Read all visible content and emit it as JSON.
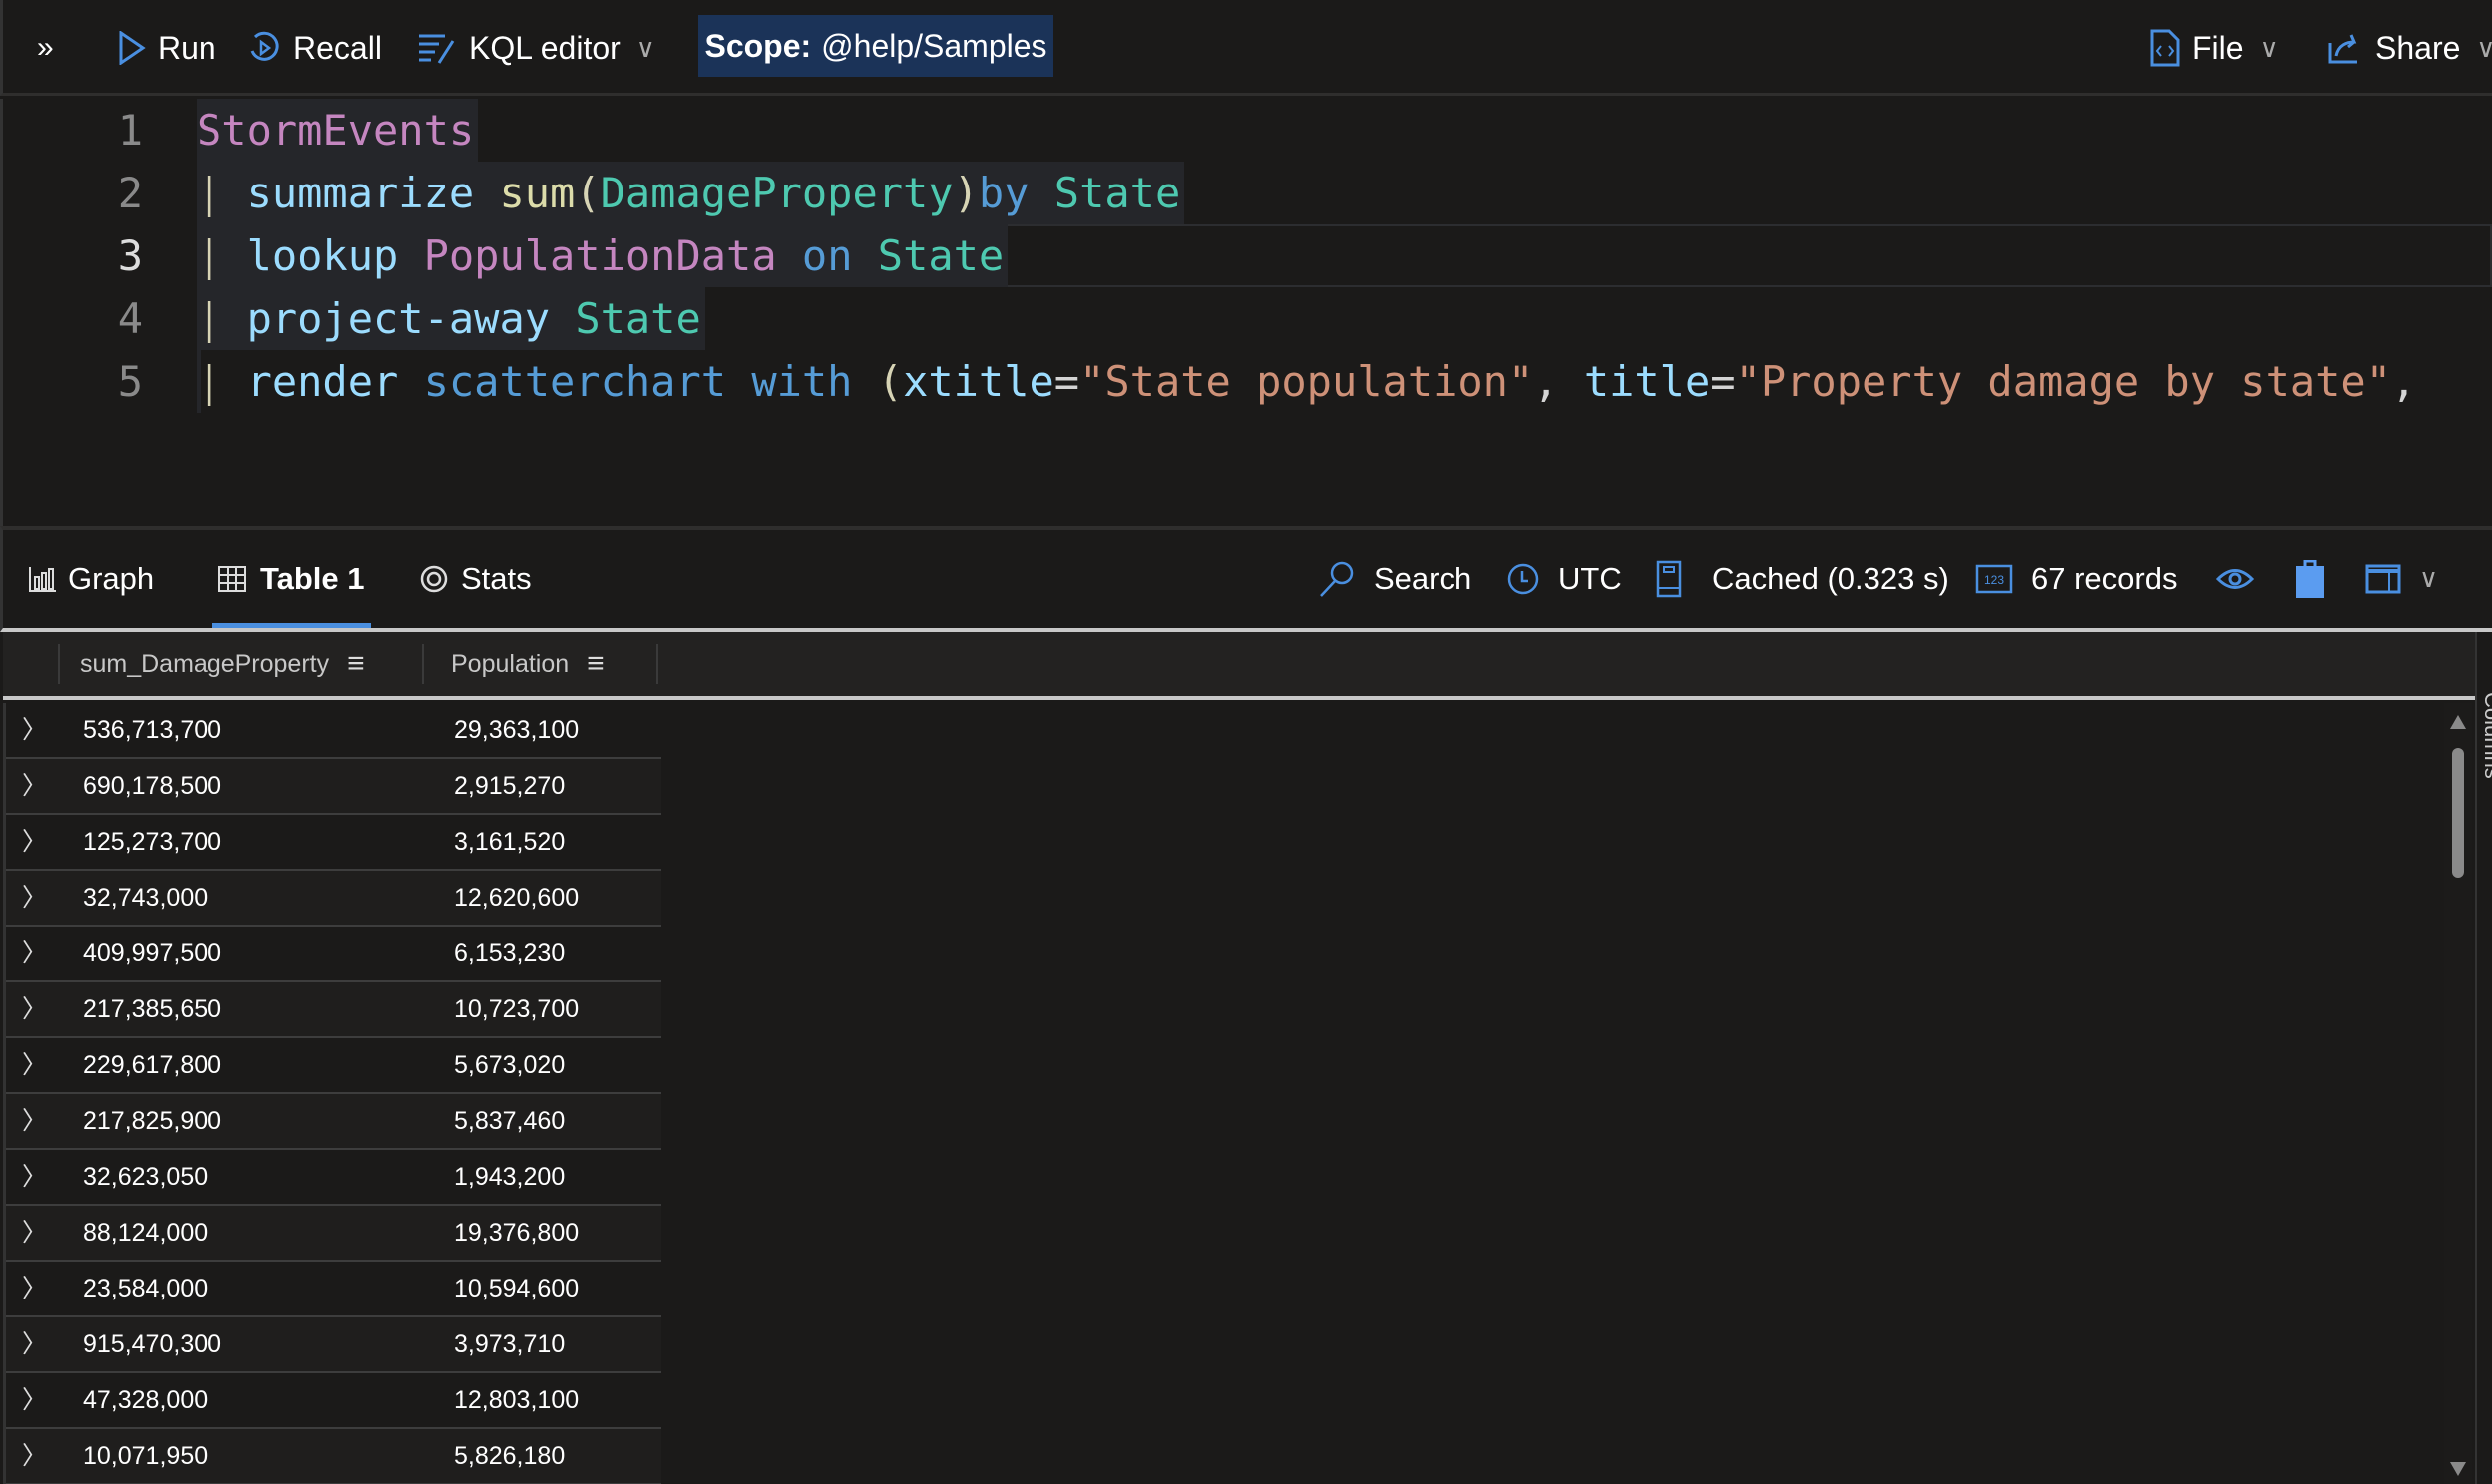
{
  "toolbar": {
    "run": "Run",
    "recall": "Recall",
    "kql_editor": "KQL editor",
    "scope_label": "Scope:",
    "scope_value": "@help/Samples",
    "file": "File",
    "share": "Share"
  },
  "editor": {
    "lines": [
      {
        "n": "1",
        "tokens": [
          "StormEvents"
        ]
      },
      {
        "n": "2",
        "tokens": [
          "summarize",
          "sum",
          "(",
          "DamageProperty",
          ")",
          "by",
          "State"
        ]
      },
      {
        "n": "3",
        "tokens": [
          "lookup",
          "PopulationData",
          "on",
          "State"
        ]
      },
      {
        "n": "4",
        "tokens": [
          "project-away",
          "State"
        ]
      },
      {
        "n": "5",
        "tokens": [
          "render",
          "scatterchart",
          "with",
          "(",
          "xtitle",
          "=",
          "\"State population\"",
          ", ",
          "title",
          "=",
          "\"Property damage by state\"",
          ","
        ]
      }
    ]
  },
  "results": {
    "tabs": [
      "Graph",
      "Table 1",
      "Stats"
    ],
    "search": "Search",
    "timezone": "UTC",
    "cached": "Cached (0.323 s)",
    "records": "67 records",
    "side_label": "Columns"
  },
  "table": {
    "columns": [
      "sum_DamageProperty",
      "Population"
    ],
    "rows": [
      [
        "536,713,700",
        "29,363,100"
      ],
      [
        "690,178,500",
        "2,915,270"
      ],
      [
        "125,273,700",
        "3,161,520"
      ],
      [
        "32,743,000",
        "12,620,600"
      ],
      [
        "409,997,500",
        "6,153,230"
      ],
      [
        "217,385,650",
        "10,723,700"
      ],
      [
        "229,617,800",
        "5,673,020"
      ],
      [
        "217,825,900",
        "5,837,460"
      ],
      [
        "32,623,050",
        "1,943,200"
      ],
      [
        "88,124,000",
        "19,376,800"
      ],
      [
        "23,584,000",
        "10,594,600"
      ],
      [
        "915,470,300",
        "3,973,710"
      ],
      [
        "47,328,000",
        "12,803,100"
      ],
      [
        "10,071,950",
        "5,826,180"
      ]
    ]
  },
  "colors": {
    "accent": "#4a8fe0",
    "scope_bg": "#1b3358",
    "background": "#1b1a19"
  }
}
